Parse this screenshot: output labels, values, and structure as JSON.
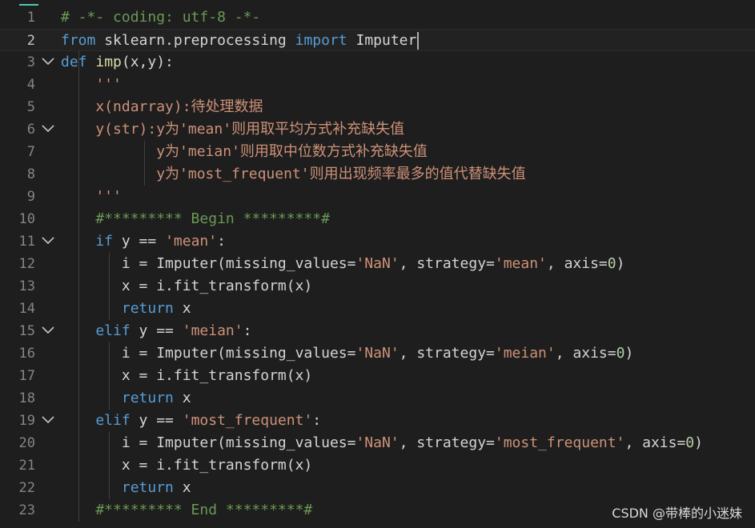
{
  "editor": {
    "lines": [
      {
        "n": "1",
        "fold": false,
        "tokens": [
          {
            "t": "com",
            "v": "# -*- coding: utf-8 -*-"
          }
        ]
      },
      {
        "n": "2",
        "fold": false,
        "current": true,
        "tokens": [
          {
            "t": "kw",
            "v": "from"
          },
          {
            "t": "id",
            "v": " sklearn.preprocessing "
          },
          {
            "t": "kw",
            "v": "import"
          },
          {
            "t": "id",
            "v": " Imputer"
          }
        ]
      },
      {
        "n": "3",
        "fold": true,
        "tokens": [
          {
            "t": "kw",
            "v": "def"
          },
          {
            "t": "id",
            "v": " "
          },
          {
            "t": "fn",
            "v": "imp"
          },
          {
            "t": "id",
            "v": "(x,y):"
          }
        ]
      },
      {
        "n": "4",
        "fold": false,
        "tokens": [
          {
            "t": "str",
            "v": "    '''"
          }
        ]
      },
      {
        "n": "5",
        "fold": false,
        "tokens": [
          {
            "t": "str",
            "v": "    x(ndarray):待处理数据"
          }
        ]
      },
      {
        "n": "6",
        "fold": true,
        "tokens": [
          {
            "t": "str",
            "v": "    y(str):y为'mean'则用取平均方式补充缺失值"
          }
        ]
      },
      {
        "n": "7",
        "fold": false,
        "tokens": [
          {
            "t": "str",
            "v": "           y为'meian'则用取中位数方式补充缺失值"
          }
        ]
      },
      {
        "n": "8",
        "fold": false,
        "tokens": [
          {
            "t": "str",
            "v": "           y为'most_frequent'则用出现频率最多的值代替缺失值"
          }
        ]
      },
      {
        "n": "9",
        "fold": false,
        "tokens": [
          {
            "t": "str",
            "v": "    '''"
          }
        ]
      },
      {
        "n": "10",
        "fold": false,
        "tokens": [
          {
            "t": "com",
            "v": "    #********* Begin *********#"
          }
        ]
      },
      {
        "n": "11",
        "fold": true,
        "tokens": [
          {
            "t": "kw",
            "v": "    if"
          },
          {
            "t": "id",
            "v": " y == "
          },
          {
            "t": "str",
            "v": "'mean'"
          },
          {
            "t": "id",
            "v": ":"
          }
        ]
      },
      {
        "n": "12",
        "fold": false,
        "tokens": [
          {
            "t": "id",
            "v": "       i = Imputer(missing_values="
          },
          {
            "t": "str",
            "v": "'NaN'"
          },
          {
            "t": "id",
            "v": ", strategy="
          },
          {
            "t": "str",
            "v": "'mean'"
          },
          {
            "t": "id",
            "v": ", axis="
          },
          {
            "t": "num",
            "v": "0"
          },
          {
            "t": "id",
            "v": ")"
          }
        ]
      },
      {
        "n": "13",
        "fold": false,
        "tokens": [
          {
            "t": "id",
            "v": "       x = i.fit_transform(x)"
          }
        ]
      },
      {
        "n": "14",
        "fold": false,
        "tokens": [
          {
            "t": "kw",
            "v": "       return"
          },
          {
            "t": "id",
            "v": " x"
          }
        ]
      },
      {
        "n": "15",
        "fold": true,
        "tokens": [
          {
            "t": "kw",
            "v": "    elif"
          },
          {
            "t": "id",
            "v": " y == "
          },
          {
            "t": "str",
            "v": "'meian'"
          },
          {
            "t": "id",
            "v": ":"
          }
        ]
      },
      {
        "n": "16",
        "fold": false,
        "tokens": [
          {
            "t": "id",
            "v": "       i = Imputer(missing_values="
          },
          {
            "t": "str",
            "v": "'NaN'"
          },
          {
            "t": "id",
            "v": ", strategy="
          },
          {
            "t": "str",
            "v": "'meian'"
          },
          {
            "t": "id",
            "v": ", axis="
          },
          {
            "t": "num",
            "v": "0"
          },
          {
            "t": "id",
            "v": ")"
          }
        ]
      },
      {
        "n": "17",
        "fold": false,
        "tokens": [
          {
            "t": "id",
            "v": "       x = i.fit_transform(x)"
          }
        ]
      },
      {
        "n": "18",
        "fold": false,
        "tokens": [
          {
            "t": "kw",
            "v": "       return"
          },
          {
            "t": "id",
            "v": " x"
          }
        ]
      },
      {
        "n": "19",
        "fold": true,
        "tokens": [
          {
            "t": "kw",
            "v": "    elif"
          },
          {
            "t": "id",
            "v": " y == "
          },
          {
            "t": "str",
            "v": "'most_frequent'"
          },
          {
            "t": "id",
            "v": ":"
          }
        ]
      },
      {
        "n": "20",
        "fold": false,
        "tokens": [
          {
            "t": "id",
            "v": "       i = Imputer(missing_values="
          },
          {
            "t": "str",
            "v": "'NaN'"
          },
          {
            "t": "id",
            "v": ", strategy="
          },
          {
            "t": "str",
            "v": "'most_frequent'"
          },
          {
            "t": "id",
            "v": ", axis="
          },
          {
            "t": "num",
            "v": "0"
          },
          {
            "t": "id",
            "v": ")"
          }
        ]
      },
      {
        "n": "21",
        "fold": false,
        "tokens": [
          {
            "t": "id",
            "v": "       x = i.fit_transform(x)"
          }
        ]
      },
      {
        "n": "22",
        "fold": false,
        "tokens": [
          {
            "t": "kw",
            "v": "       return"
          },
          {
            "t": "id",
            "v": " x"
          }
        ]
      },
      {
        "n": "23",
        "fold": false,
        "tokens": [
          {
            "t": "com",
            "v": "    #********* End *********#"
          }
        ]
      }
    ]
  },
  "watermark": "CSDN @带棒的小迷妹",
  "colors": {
    "background": "#1e1e1e",
    "keyword": "#569cd6",
    "string": "#ce9178",
    "comment": "#6a9955",
    "number": "#b5cea8",
    "text": "#d4d4d4",
    "line_number": "#858585"
  }
}
